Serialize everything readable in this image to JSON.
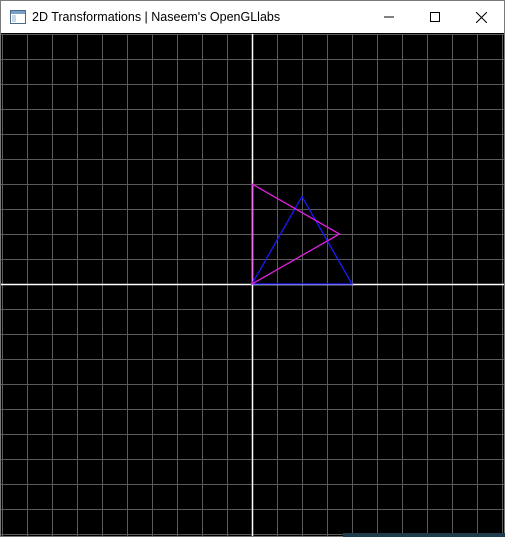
{
  "window": {
    "title": "2D Transformations  | Naseem's OpenGLlabs",
    "icon": "opengl-window-icon"
  },
  "controls": {
    "minimize_icon": "minimize-icon",
    "maximize_icon": "maximize-icon",
    "close_icon": "close-icon"
  },
  "scene": {
    "background": "#000000",
    "grid_color": "#5a5a5a",
    "axis_color": "#ffffff",
    "grid_range": [
      -10,
      10
    ],
    "grid_step": 1,
    "original_triangle": {
      "color": "#1a1aff",
      "vertices": [
        [
          0,
          0
        ],
        [
          4,
          0
        ],
        [
          2,
          3.5
        ]
      ]
    },
    "transformed_triangle": {
      "color": "#e020e0",
      "vertices": [
        [
          0,
          0
        ],
        [
          3.5,
          2
        ],
        [
          0,
          4
        ]
      ]
    }
  }
}
